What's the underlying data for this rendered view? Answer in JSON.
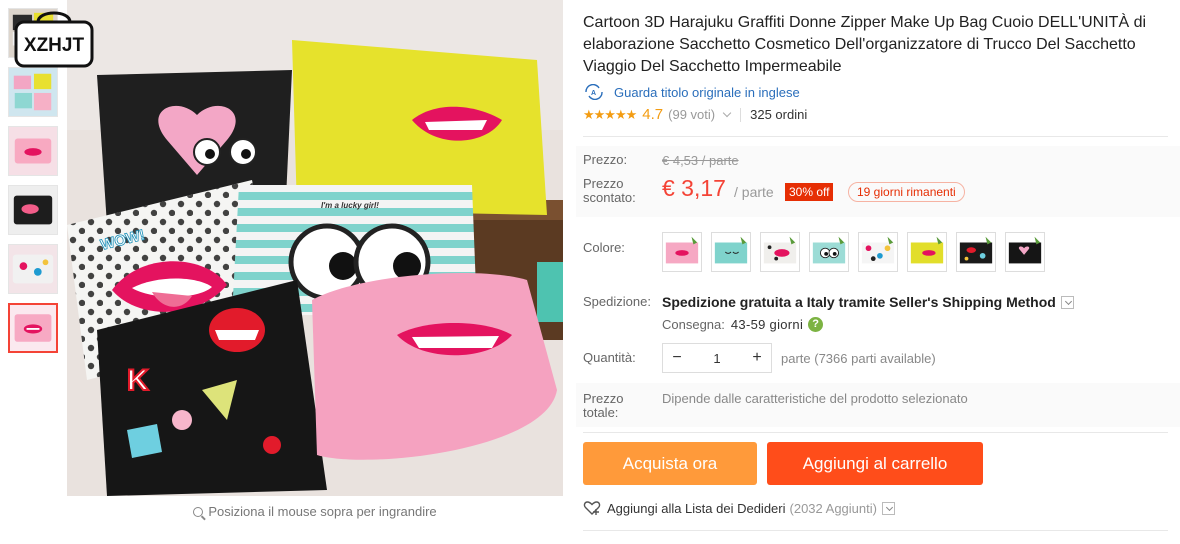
{
  "brand": {
    "logo_text": "XZHJT"
  },
  "gallery": {
    "thumbnails": [
      {
        "name": "thumb-1"
      },
      {
        "name": "thumb-2"
      },
      {
        "name": "thumb-3"
      },
      {
        "name": "thumb-4"
      },
      {
        "name": "thumb-5"
      },
      {
        "name": "thumb-6"
      }
    ],
    "zoom_hint": "Posiziona il mouse sopra per ingrandire",
    "image_texts": {
      "wow": "WOW!",
      "lucky": "I'm a lucky girl!"
    }
  },
  "product": {
    "title": "Cartoon 3D Harajuku Graffiti Donne Zipper Make Up Bag Cuoio DELL'UNITÀ di elaborazione Sacchetto Cosmetico Dell'organizzatore di Trucco Del Sacchetto Viaggio Del Sacchetto Impermeabile",
    "original_title_link": "Guarda titolo originale in inglese",
    "stars": "★★★★★",
    "rating": "4.7",
    "votes": "(99 voti)",
    "orders": "325 ordini"
  },
  "price": {
    "price_label": "Prezzo:",
    "old_price": "€ 4,53 / parte",
    "discount_label_1": "Prezzo",
    "discount_label_2": "scontato:",
    "new_price": "€ 3,17",
    "per_part": "/ parte",
    "discount_badge": "30% off",
    "days_left": "19 giorni rimanenti"
  },
  "color": {
    "label": "Colore:",
    "swatches": [
      "swatch-1",
      "swatch-2",
      "swatch-3",
      "swatch-4",
      "swatch-5",
      "swatch-6",
      "swatch-7",
      "swatch-8"
    ]
  },
  "shipping": {
    "label": "Spedizione:",
    "method": "Spedizione gratuita a Italy tramite Seller's Shipping Method",
    "delivery_label": "Consegna:",
    "delivery_days": "43-59 giorni",
    "help": "?"
  },
  "quantity": {
    "label": "Quantità:",
    "minus": "−",
    "value": "1",
    "plus": "+",
    "available": "parte (7366 parti available)"
  },
  "total": {
    "label_1": "Prezzo",
    "label_2": "totale:",
    "value": "Dipende dalle caratteristiche del prodotto selezionato"
  },
  "actions": {
    "buy_now": "Acquista ora",
    "add_to_cart": "Aggiungi al carrello",
    "wishlist": "Aggiungi alla Lista dei Dedideri",
    "wishlist_count": "(2032 Aggiunti)"
  },
  "colors": {
    "accent_red": "#f44336",
    "buy_orange": "#ff9a3a",
    "cart_orange": "#ff4d1a",
    "link_blue": "#2a6ebb",
    "star": "#f39c12"
  }
}
